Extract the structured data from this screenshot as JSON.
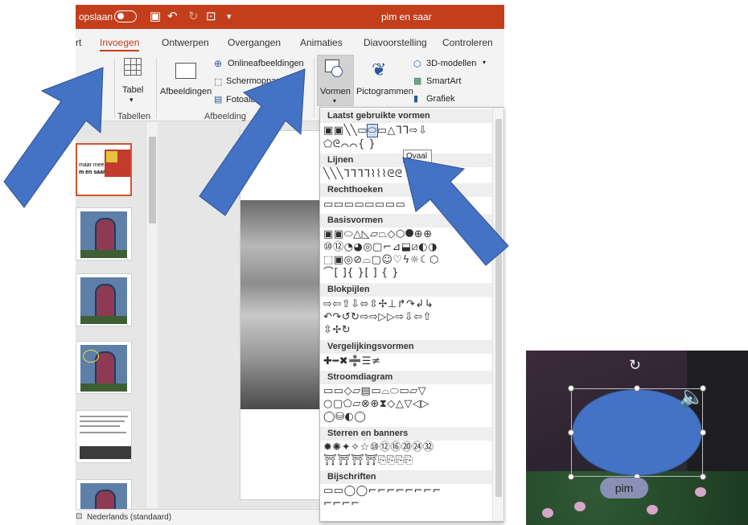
{
  "titlebar": {
    "autosave_label": "opslaan",
    "icons": [
      "save-icon",
      "undo-icon",
      "redo-icon",
      "present-icon",
      "customize-icon"
    ],
    "doc_title": "pim en saar",
    "accent_color": "#c43e1c"
  },
  "tabs": [
    {
      "label": "rt"
    },
    {
      "label": "Invoegen",
      "active": true
    },
    {
      "label": "Ontwerpen"
    },
    {
      "label": "Overgangen"
    },
    {
      "label": "Animaties"
    },
    {
      "label": "Diavoorstelling"
    },
    {
      "label": "Controleren"
    }
  ],
  "ribbon": {
    "tabel_label": "Tabel",
    "tabellen_group": "Tabellen",
    "afbeeldingen_label": "Afbeeldingen",
    "online_afbeeldingen": "Onlineafbeeldingen",
    "schermopname": "Schermopname",
    "fotoalbum": "Fotoalbum",
    "afbeeldingen_group": "Afbeelding",
    "vormen_label": "Vormen",
    "pictogrammen_label": "Pictogrammen",
    "modellen_3d": "3D-modellen",
    "smartart": "SmartArt",
    "grafiek": "Grafiek"
  },
  "slides": {
    "first_text": [
      "maar mee",
      "m en saar"
    ]
  },
  "shapes_menu": {
    "categories": [
      "Laatst gebruikte vormen",
      "Lijnen",
      "Rechthoeken",
      "Basisvormen",
      "Blokpijlen",
      "Vergelijkingsvormen",
      "Stroomdiagram",
      "Sterren en banners",
      "Bijschriften"
    ],
    "tooltip": "Ovaal"
  },
  "statusbar": {
    "language": "Nederlands (standaard)"
  },
  "inset": {
    "label": "pim",
    "oval_color": "#4472c4"
  },
  "arrow_color": "#4472c4"
}
